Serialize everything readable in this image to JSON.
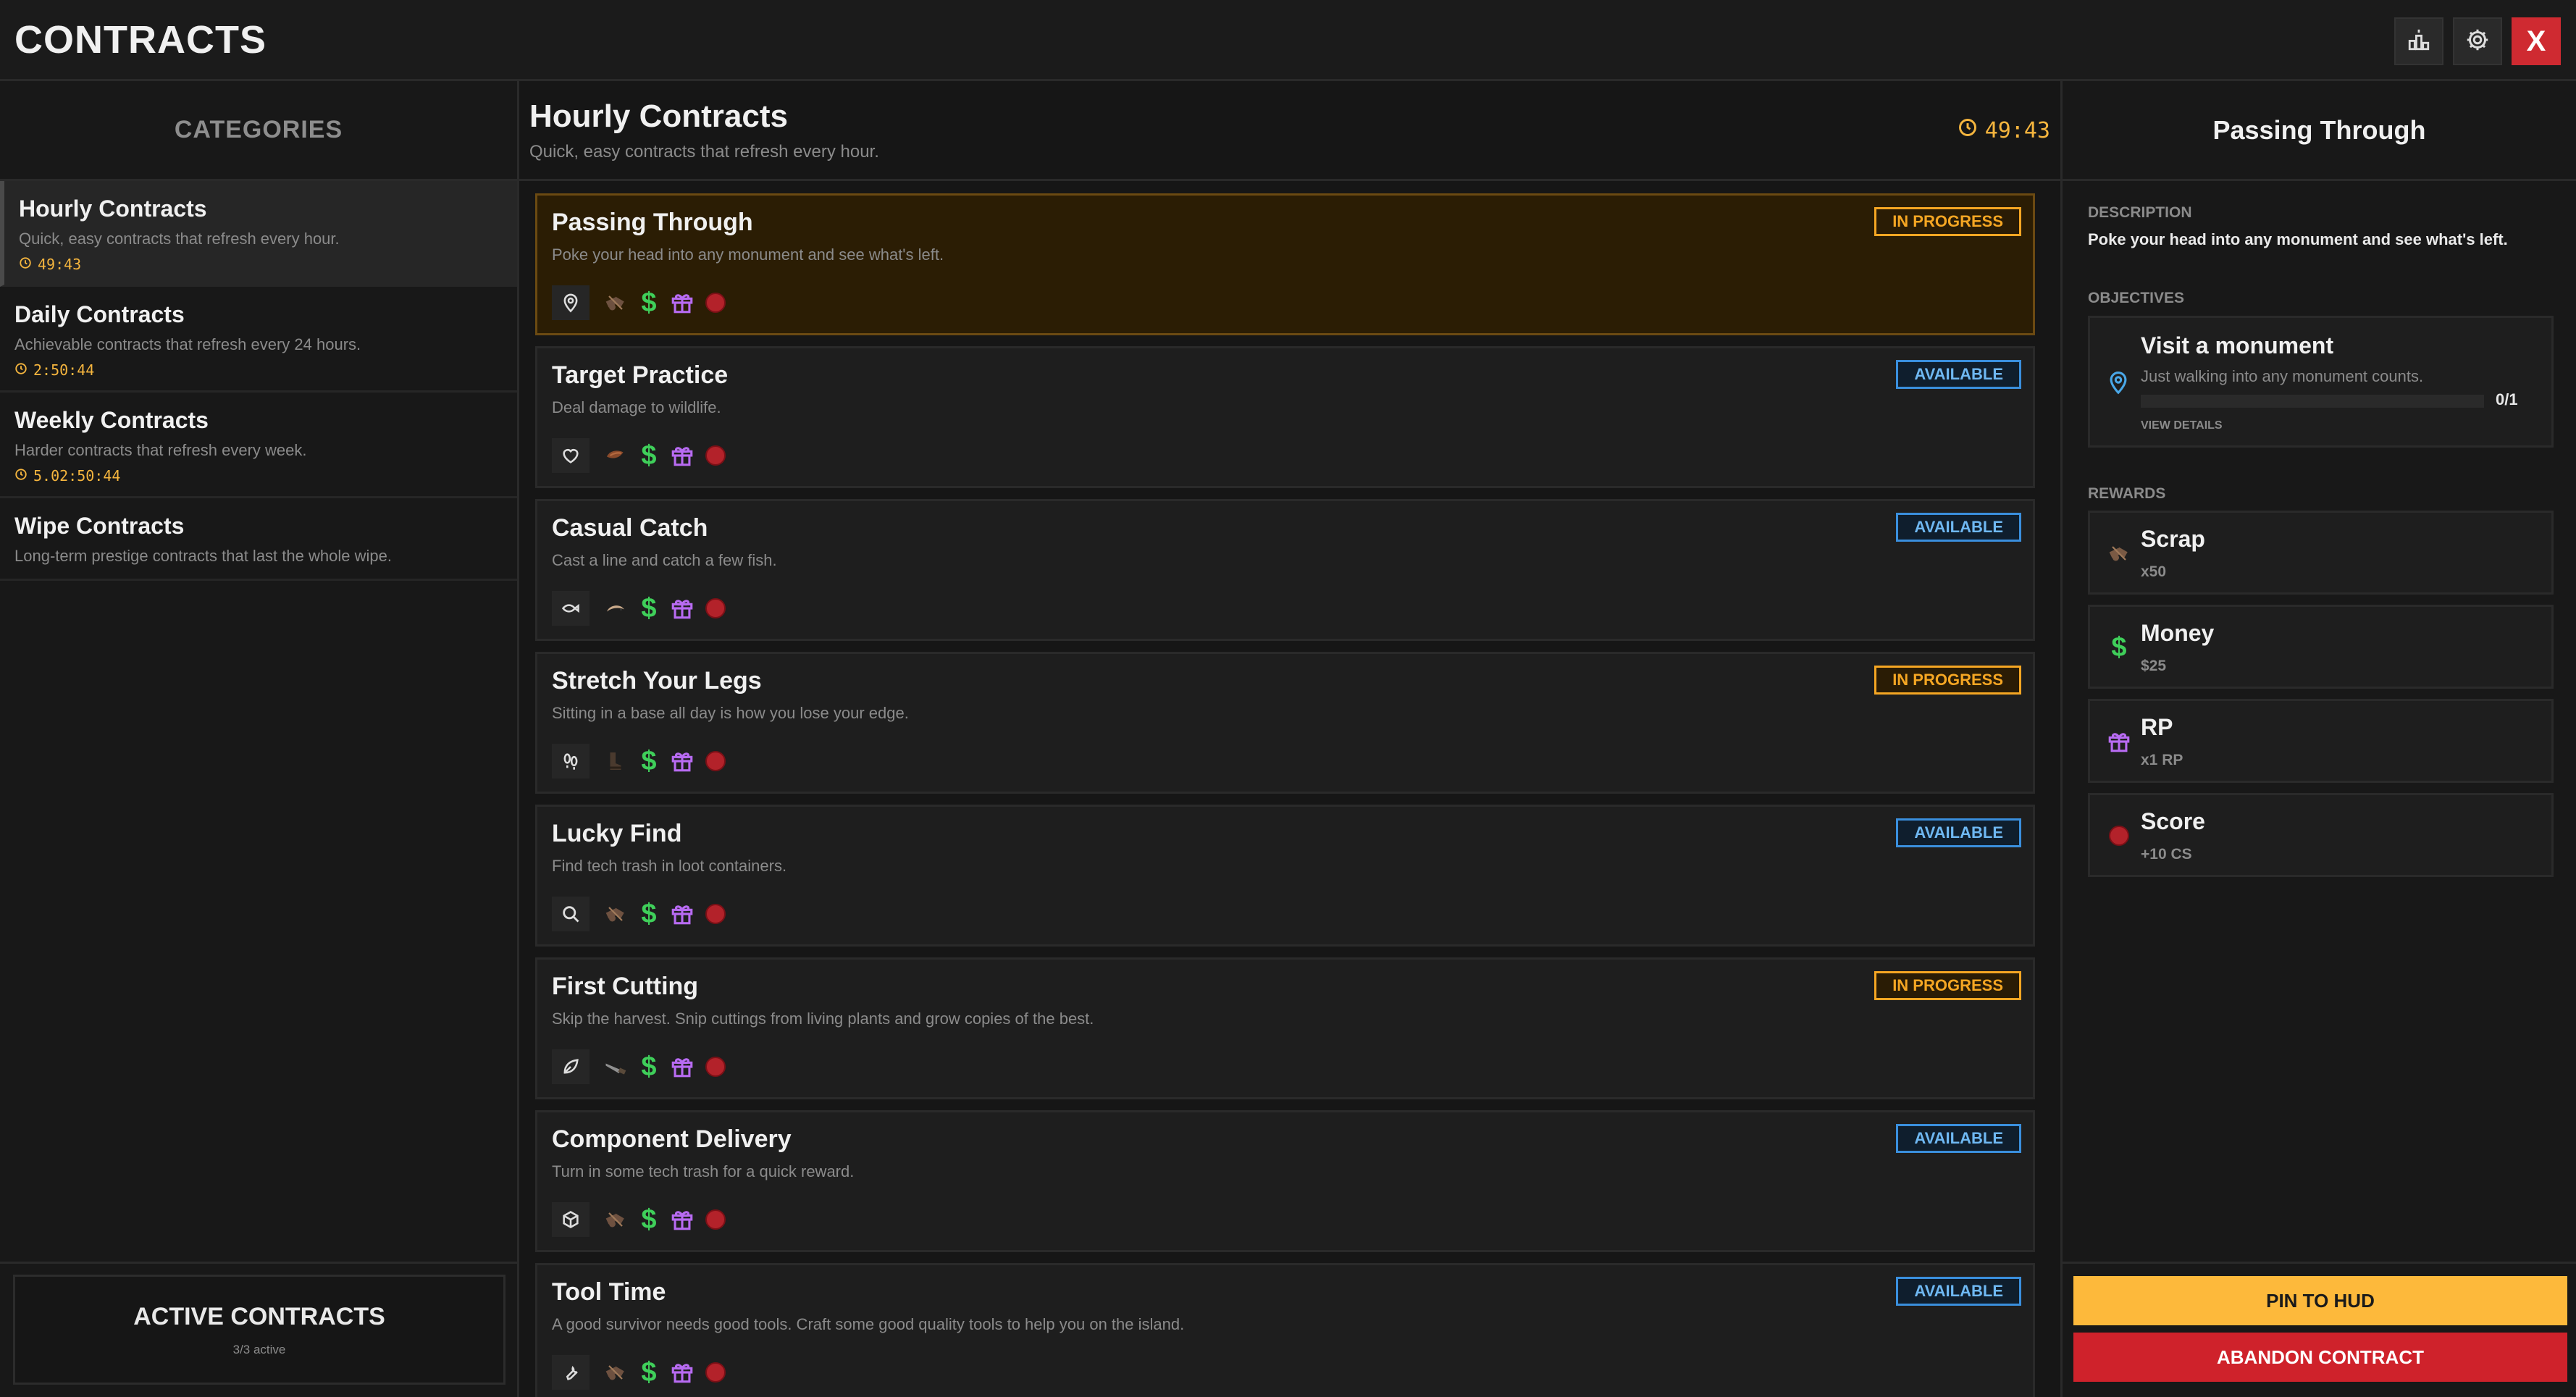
{
  "header": {
    "title": "CONTRACTS",
    "close_label": "X"
  },
  "colors": {
    "accent": "#fdb93b",
    "danger": "#cf222b",
    "in_progress": "#f5a623",
    "available": "#3a8fdd",
    "money": "#3fcf5a",
    "rp": "#b86bf2"
  },
  "categories": {
    "title": "CATEGORIES",
    "items": [
      {
        "name": "Hourly Contracts",
        "desc": "Quick, easy contracts that refresh every hour.",
        "timer": "49:43"
      },
      {
        "name": "Daily Contracts",
        "desc": "Achievable contracts that refresh every 24 hours.",
        "timer": "2:50:44"
      },
      {
        "name": "Weekly Contracts",
        "desc": "Harder contracts that refresh every week.",
        "timer": "5.02:50:44"
      },
      {
        "name": "Wipe Contracts",
        "desc": "Long-term prestige contracts that last the whole wipe.",
        "timer": ""
      }
    ],
    "active_title": "ACTIVE CONTRACTS",
    "active_sub": "3/3 active"
  },
  "main": {
    "title": "Hourly Contracts",
    "subtitle": "Quick, easy contracts that refresh every hour.",
    "timer": "49:43",
    "contracts": [
      {
        "name": "Passing Through",
        "desc": "Poke your head into any monument and see what's left.",
        "status": "IN PROGRESS",
        "icon": "map-pin-icon",
        "item_icon": "scrap-icon"
      },
      {
        "name": "Target Practice",
        "desc": "Deal damage to wildlife.",
        "status": "AVAILABLE",
        "icon": "heart-icon",
        "item_icon": "meat-icon"
      },
      {
        "name": "Casual Catch",
        "desc": "Cast a line and catch a few fish.",
        "status": "AVAILABLE",
        "icon": "fish-icon",
        "item_icon": "bait-icon"
      },
      {
        "name": "Stretch Your Legs",
        "desc": "Sitting in a base all day is how you lose your edge.",
        "status": "IN PROGRESS",
        "icon": "footprints-icon",
        "item_icon": "boots-icon"
      },
      {
        "name": "Lucky Find",
        "desc": "Find tech trash in loot containers.",
        "status": "AVAILABLE",
        "icon": "search-icon",
        "item_icon": "scrap-icon"
      },
      {
        "name": "First Cutting",
        "desc": "Skip the harvest. Snip cuttings from living plants and grow copies of the best.",
        "status": "IN PROGRESS",
        "icon": "leaf-icon",
        "item_icon": "knife-icon"
      },
      {
        "name": "Component Delivery",
        "desc": "Turn in some tech trash for a quick reward.",
        "status": "AVAILABLE",
        "icon": "box-icon",
        "item_icon": "scrap-icon"
      },
      {
        "name": "Tool Time",
        "desc": "A good survivor needs good tools. Craft some good quality tools to help you on the island.",
        "status": "AVAILABLE",
        "icon": "wrench-icon",
        "item_icon": "scrap-icon"
      }
    ]
  },
  "detail": {
    "title": "Passing Through",
    "description_label": "DESCRIPTION",
    "description": "Poke your head into any monument and see what's left.",
    "objectives_label": "OBJECTIVES",
    "objective": {
      "title": "Visit a monument",
      "desc": "Just walking into any monument counts.",
      "progress": "0/1",
      "progress_fraction": 0,
      "view_details": "VIEW DETAILS"
    },
    "rewards_label": "REWARDS",
    "rewards": [
      {
        "name": "Scrap",
        "amount": "x50",
        "icon": "scrap-icon"
      },
      {
        "name": "Money",
        "amount": "$25",
        "icon": "dollar-icon"
      },
      {
        "name": "RP",
        "amount": "x1 RP",
        "icon": "gift-icon"
      },
      {
        "name": "Score",
        "amount": "+10 CS",
        "icon": "score-icon"
      }
    ],
    "pin_label": "PIN TO HUD",
    "abandon_label": "ABANDON CONTRACT"
  }
}
